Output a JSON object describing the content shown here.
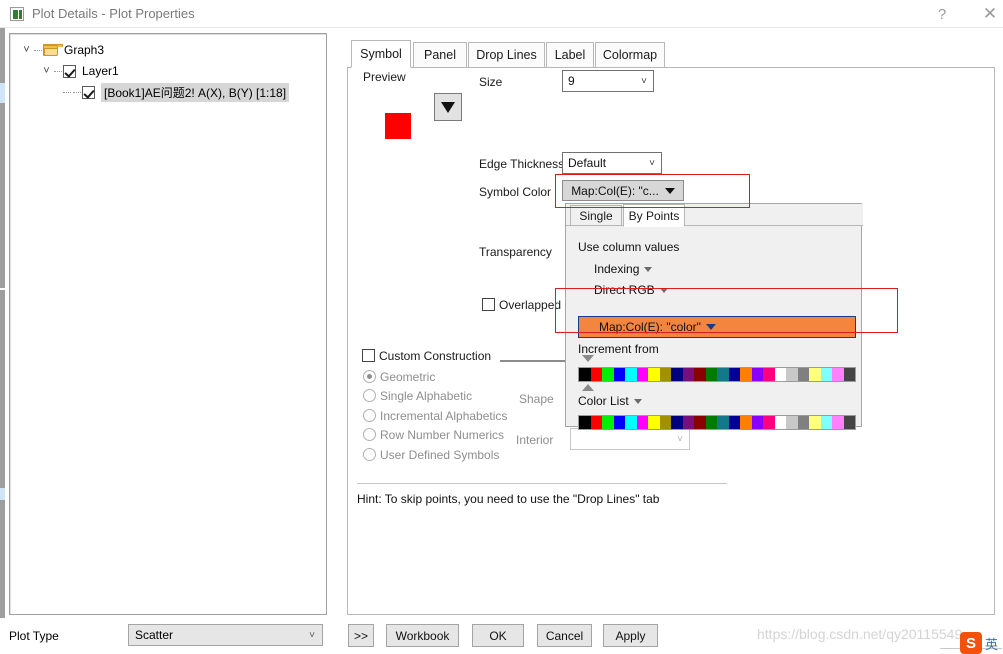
{
  "window": {
    "title": "Plot Details - Plot Properties",
    "icon": "plot-details-icon",
    "help_label": "?",
    "close_label": "✕"
  },
  "tree": {
    "nodes": [
      {
        "label": "Graph3",
        "icon": "folder-icon",
        "expanded": true
      },
      {
        "label": "Layer1",
        "icon": "checkbox-checked-icon",
        "checked": true,
        "expanded": true
      },
      {
        "label": "[Book1]AE问题2! A(X), B(Y) [1:18]",
        "icon": "checkbox-checked-icon",
        "checked": true,
        "selected": true
      }
    ]
  },
  "tabs": [
    {
      "label": "Symbol",
      "active": true
    },
    {
      "label": "Panel",
      "active": false
    },
    {
      "label": "Drop Lines",
      "active": false
    },
    {
      "label": "Label",
      "active": false
    },
    {
      "label": "Colormap",
      "active": false
    }
  ],
  "symbol": {
    "preview_label": "Preview",
    "preview_color": "#fe0000",
    "shape_dropdown_icon": "triangle-down-icon",
    "size_label": "Size",
    "size_value": "9",
    "edge_thickness_label": "Edge Thickness",
    "edge_thickness_value": "Default",
    "symbol_color_label": "Symbol Color",
    "symbol_color_value": "Map:Col(E): \"c...",
    "transparency_label": "Transparency",
    "overlapped_label": "Overlapped P",
    "shape_label": "Shape",
    "interior_label": "Interior",
    "interior_value": ""
  },
  "flyout": {
    "tabs": [
      {
        "label": "Single",
        "active": false
      },
      {
        "label": "By Points",
        "active": true
      }
    ],
    "use_column_values_label": "Use column values",
    "indexing_label": "Indexing",
    "direct_rgb_label": "Direct RGB",
    "map_col_label": "Map:Col(E): \"color\"",
    "map_col_bg": "#f3853e",
    "increment_from_label": "Increment from",
    "color_list_label": "Color List",
    "increment_palette": [
      "#000000",
      "#fe0000",
      "#00f000",
      "#0000ff",
      "#00ffff",
      "#ff00ff",
      "#ffff00",
      "#a39000",
      "#000080",
      "#7a0f7a",
      "#8b0000",
      "#007a00",
      "#13788a",
      "#000094",
      "#ff8000",
      "#8a00ff",
      "#ff0080",
      "#ffffff",
      "#c8c8c8",
      "#808080",
      "#ffff80",
      "#80ffff",
      "#ff80ff",
      "#444444"
    ],
    "color_list_palette": [
      "#000000",
      "#fe0000",
      "#00f000",
      "#0000ff",
      "#00ffff",
      "#ff00ff",
      "#ffff00",
      "#a39000",
      "#000080",
      "#7a0f7a",
      "#8b0000",
      "#007a00",
      "#13788a",
      "#000094",
      "#ff8000",
      "#8a00ff",
      "#ff0080",
      "#ffffff",
      "#c8c8c8",
      "#808080",
      "#ffff80",
      "#80ffff",
      "#ff80ff",
      "#444444"
    ]
  },
  "custom_construction": {
    "label": "Custom Construction",
    "checked": false,
    "options": [
      {
        "label": "Geometric",
        "selected": true
      },
      {
        "label": "Single Alphabetic",
        "selected": false
      },
      {
        "label": "Incremental Alphabetics",
        "selected": false
      },
      {
        "label": "Row Number Numerics",
        "selected": false
      },
      {
        "label": "User Defined Symbols",
        "selected": false
      }
    ]
  },
  "hint": {
    "text": "Hint: To skip points, you need to use the \"Drop Lines\" tab"
  },
  "footer": {
    "plot_type_label": "Plot Type",
    "plot_type_value": "Scatter",
    "buttons": [
      {
        "name": "more",
        "label": ">>"
      },
      {
        "name": "workbook",
        "label": "Workbook"
      },
      {
        "name": "ok",
        "label": "OK"
      },
      {
        "name": "cancel",
        "label": "Cancel"
      },
      {
        "name": "apply",
        "label": "Apply"
      }
    ]
  },
  "watermark": {
    "url": "https://blog.csdn.net/qy20115549",
    "logo_letter": "S",
    "cn_text": "英"
  },
  "annotations": {
    "highlight_color": "#e01b1b",
    "boxes": 2
  }
}
